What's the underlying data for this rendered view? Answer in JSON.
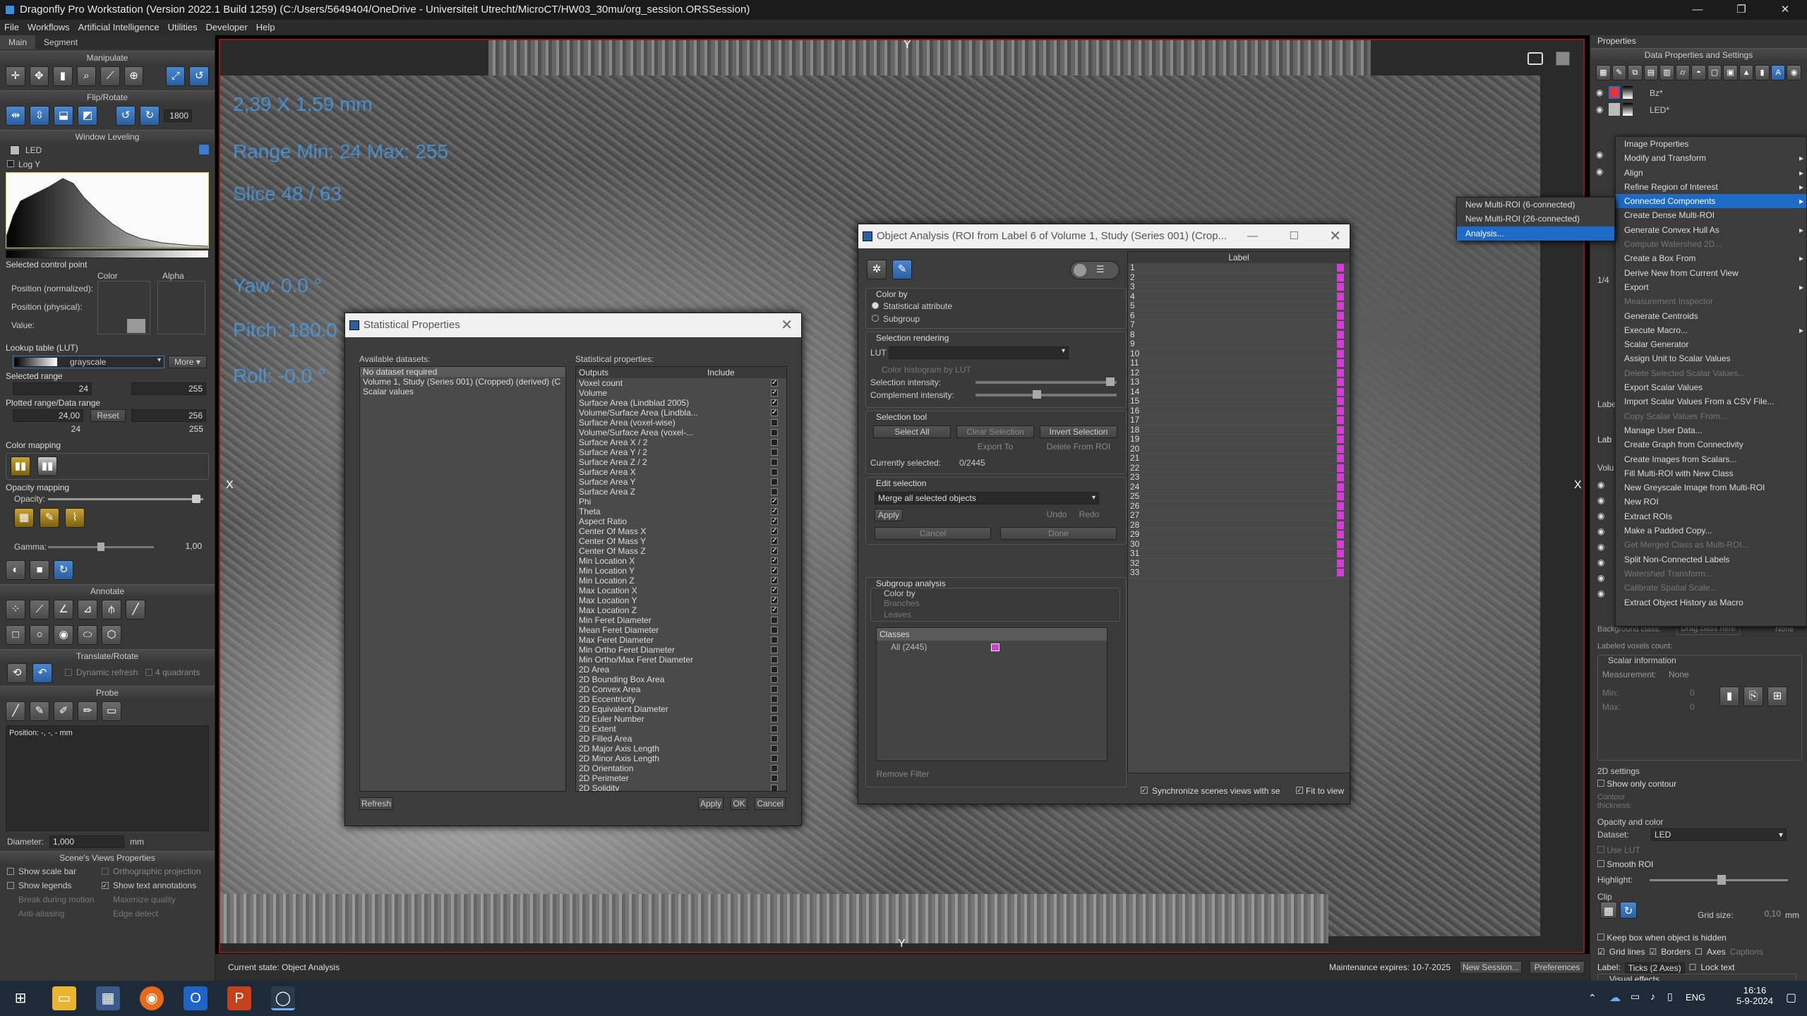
{
  "window": {
    "title": "Dragonfly Pro Workstation (Version 2022.1 Build 1259) (C:/Users/5649404/OneDrive - Universiteit Utrecht/MicroCT/HW03_30mu/org_session.ORSSession)"
  },
  "menu": [
    "File",
    "Workflows",
    "Artificial Intelligence",
    "Utilities",
    "Developer",
    "Help"
  ],
  "left": {
    "tabs": [
      "Main",
      "Segment"
    ],
    "sections": {
      "manipulate": "Manipulate",
      "flip": "Flip/Rotate",
      "window": "Window Leveling",
      "annotate": "Annotate",
      "translate": "Translate/Rotate",
      "probe": "Probe",
      "scene": "Scene's Views Properties"
    },
    "rotate_value": "1800",
    "dataset_name": "LED",
    "logy": "Log Y",
    "control_point": "Selected control point",
    "color_hdr": "Color",
    "alpha_hdr": "Alpha",
    "pos_norm": "Position (normalized):",
    "pos_phys": "Position (physical):",
    "value": "Value:",
    "lut_hdr": "Lookup table (LUT)",
    "lut_value": "grayscale",
    "more": "More",
    "sel_range": "Selected range",
    "sel_min": "24",
    "sel_max": "255",
    "plotted": "Plotted range/Data range",
    "pr_min": "24,00",
    "pr_reset": "Reset",
    "pr_max": "256",
    "dr_min": "24",
    "dr_max": "255",
    "color_mapping": "Color mapping",
    "opacity_mapping": "Opacity mapping",
    "opacity": "Opacity:",
    "gamma": "Gamma:",
    "gamma_val": "1,00",
    "dynamic_refresh": "Dynamic refresh",
    "quadrants": "4 quadrants",
    "position": "Position: -, -, - mm",
    "diameter": "Diameter:",
    "diameter_val": "1,000",
    "diameter_unit": "mm",
    "scene_opts": [
      [
        "Show scale bar",
        "Orthographic projection"
      ],
      [
        "Show legends",
        "Show text annotations"
      ],
      [
        "Break during motion",
        "Maximize quality"
      ],
      [
        "Anti-aliasing",
        "Edge detect"
      ]
    ]
  },
  "viewport": {
    "overlay": [
      "2,39 X 1,59 mm",
      "Range Min: 24 Max: 255",
      "Slice 48 / 63",
      "Yaw: 0.0 °",
      "Pitch: 180.0 °",
      "Roll: -0.0 °"
    ],
    "axis_top": "Y",
    "axis_bottom": "Y",
    "axis_left": "X",
    "axis_right": "X"
  },
  "stat": {
    "title": "Statistical Properties",
    "available": "Available datasets:",
    "datasets": [
      "No dataset required",
      "Volume 1, Study  (Series 001) (Cropped) (derived) (C",
      "Scalar values"
    ],
    "props_label": "Statistical properties:",
    "col_outputs": "Outputs",
    "col_include": "Include",
    "outputs": [
      "Voxel count",
      "Volume",
      "Surface Area (Lindblad 2005)",
      "Volume/Surface Area (Lindbla...",
      "Surface Area (voxel-wise)",
      "Volume/Surface Area (voxel-...",
      "Surface Area X / 2",
      "Surface Area Y / 2",
      "Surface Area Z / 2",
      "Surface Area X",
      "Surface Area Y",
      "Surface Area Z",
      "Phi",
      "Theta",
      "Aspect Ratio",
      "Center Of Mass X",
      "Center Of Mass Y",
      "Center Of Mass Z",
      "Min Location X",
      "Min Location Y",
      "Min Location Z",
      "Max Location X",
      "Max Location Y",
      "Max Location Z",
      "Min Feret Diameter",
      "Mean Feret Diameter",
      "Max Feret Diameter",
      "Min Ortho Feret Diameter",
      "Min Ortho/Max Feret Diameter",
      "2D Area",
      "2D Bounding Box Area",
      "2D Convex Area",
      "2D Eccentricity",
      "2D Equivalent Diameter",
      "2D Euler Number",
      "2D Extent",
      "2D Filled Area",
      "2D Major Axis Length",
      "2D Minor Axis Length",
      "2D Orientation",
      "2D Perimeter",
      "2D Solidity"
    ],
    "checked": [
      true,
      true,
      true,
      true,
      false,
      false,
      false,
      false,
      false,
      false,
      false,
      false,
      true,
      true,
      true,
      true,
      true,
      true,
      true,
      true,
      true,
      true,
      true,
      true,
      false,
      false,
      false,
      false,
      false,
      false,
      false,
      false,
      false,
      false,
      false,
      false,
      false,
      false,
      false,
      false,
      false,
      false
    ],
    "refresh": "Refresh",
    "apply": "Apply",
    "ok": "OK",
    "cancel": "Cancel"
  },
  "obj": {
    "title": "Object Analysis (ROI from Label 6 of Volume 1, Study  (Series 001) (Crop...",
    "color_by": "Color by",
    "stat_attr": "Statistical attribute",
    "subgroup": "Subgroup",
    "sel_rendering": "Selection rendering",
    "lut": "LUT",
    "color_hist": "Color histogram by LUT",
    "sel_intensity": "Selection intensity:",
    "comp_intensity": "Complement intensity:",
    "sel_tool": "Selection tool",
    "select_all": "Select All",
    "clear_sel": "Clear Selection",
    "invert_sel": "Invert Selection",
    "export_to": "Export To",
    "delete_roi": "Delete From ROI",
    "currently": "Currently selected:",
    "currently_val": "0/2445",
    "edit_sel": "Edit selection",
    "merge": "Merge all selected objects",
    "apply": "Apply",
    "undo": "Undo",
    "redo": "Redo",
    "cancel": "Cancel",
    "done": "Done",
    "subgroup_analysis": "Subgroup analysis",
    "branches": "Branches",
    "leaves": "Leaves",
    "classes": "Classes",
    "all": "All (2445)",
    "remove_filter": "Remove Filter",
    "label_hdr": "Label",
    "labels": [
      "1",
      "2",
      "3",
      "4",
      "5",
      "6",
      "7",
      "8",
      "9",
      "10",
      "11",
      "12",
      "13",
      "14",
      "15",
      "16",
      "17",
      "18",
      "19",
      "20",
      "21",
      "22",
      "23",
      "24",
      "25",
      "26",
      "27",
      "28",
      "29",
      "30",
      "31",
      "32",
      "33"
    ],
    "sync": "Synchronize scenes views with se",
    "fit": "Fit to view"
  },
  "right": {
    "properties": "Properties",
    "data_props": "Data Properties and Settings",
    "items": [
      "Bz*",
      "LED*"
    ],
    "ctx": [
      {
        "label": "Image Properties",
        "dis": false,
        "sub": false,
        "sel": false
      },
      {
        "label": "Modify and Transform",
        "dis": false,
        "sub": true,
        "sel": false
      },
      {
        "label": "Align",
        "dis": false,
        "sub": true,
        "sel": false
      },
      {
        "label": "Refine Region of Interest",
        "dis": false,
        "sub": true,
        "sel": false
      },
      {
        "label": "Connected Components",
        "dis": false,
        "sub": true,
        "sel": true
      },
      {
        "label": "Create Dense Multi-ROI",
        "dis": false,
        "sub": false,
        "sel": false
      },
      {
        "label": "Generate Convex Hull As",
        "dis": false,
        "sub": true,
        "sel": false
      },
      {
        "label": "Compute Watershed 2D...",
        "dis": true,
        "sub": false,
        "sel": false
      },
      {
        "label": "Create a Box From",
        "dis": false,
        "sub": true,
        "sel": false
      },
      {
        "label": "Derive New from Current View",
        "dis": false,
        "sub": false,
        "sel": false
      },
      {
        "label": "Export",
        "dis": false,
        "sub": true,
        "sel": false
      },
      {
        "label": "Measurement Inspector",
        "dis": true,
        "sub": false,
        "sel": false
      },
      {
        "label": "Generate Centroids",
        "dis": false,
        "sub": false,
        "sel": false
      },
      {
        "label": "Execute Macro...",
        "dis": false,
        "sub": true,
        "sel": false
      },
      {
        "label": "Scalar Generator",
        "dis": false,
        "sub": false,
        "sel": false
      },
      {
        "label": "Assign Unit to Scalar Values",
        "dis": false,
        "sub": false,
        "sel": false
      },
      {
        "label": "Delete Selected Scalar Values...",
        "dis": true,
        "sub": false,
        "sel": false
      },
      {
        "label": "Export Scalar Values",
        "dis": false,
        "sub": false,
        "sel": false
      },
      {
        "label": "Import Scalar Values From a CSV File...",
        "dis": false,
        "sub": false,
        "sel": false
      },
      {
        "label": "Copy Scalar Values From...",
        "dis": true,
        "sub": false,
        "sel": false
      },
      {
        "label": "Manage User Data...",
        "dis": false,
        "sub": false,
        "sel": false
      },
      {
        "label": "Create Graph from Connectivity",
        "dis": false,
        "sub": false,
        "sel": false
      },
      {
        "label": "Create Images from Scalars...",
        "dis": false,
        "sub": false,
        "sel": false
      },
      {
        "label": "Fill Multi-ROI with New Class",
        "dis": false,
        "sub": false,
        "sel": false
      },
      {
        "label": "New Greyscale Image from Multi-ROI",
        "dis": false,
        "sub": false,
        "sel": false
      },
      {
        "label": "New ROI",
        "dis": false,
        "sub": false,
        "sel": false
      },
      {
        "label": "Extract ROIs",
        "dis": false,
        "sub": false,
        "sel": false
      },
      {
        "label": "Make a Padded Copy...",
        "dis": false,
        "sub": false,
        "sel": false
      },
      {
        "label": "Get Merged Class as Multi-ROI...",
        "dis": true,
        "sub": false,
        "sel": false
      },
      {
        "label": "Split Non-Connected Labels",
        "dis": false,
        "sub": false,
        "sel": false
      },
      {
        "label": "Watershed Transform...",
        "dis": true,
        "sub": false,
        "sel": false
      },
      {
        "label": "Calibrate Spatial Scale...",
        "dis": true,
        "sub": false,
        "sel": false
      },
      {
        "label": "Extract Object History as Macro",
        "dis": false,
        "sub": false,
        "sel": false
      }
    ],
    "submenu": [
      "New Multi-ROI (6-connected)",
      "New Multi-ROI (26-connected)",
      "Analysis..."
    ],
    "bg_class": "Background class:",
    "drag_class": "Drag class here",
    "none": "None",
    "labeled_voxels": "Labeled voxels count:",
    "scalar_info": "Scalar information",
    "measurement": "Measurement:",
    "meas_val": "None",
    "min": "Min:",
    "max": "Max:",
    "zero": "0",
    "settings2d": "2D settings",
    "only_contour": "Show only contour",
    "contour_thickness": "Contour thickness:",
    "opacity_color": "Opacity and color",
    "dataset": "Dataset:",
    "dataset_val": "LED",
    "use_lut": "Use LUT",
    "smooth": "Smooth ROI",
    "highlight": "Highlight:",
    "clip": "Clip",
    "grid_size": "Grid size:",
    "grid_val": "0,10",
    "grid_unit": "mm",
    "keep_box": "Keep box when object is hidden",
    "grid_lines": "Grid lines",
    "borders": "Borders",
    "axes": "Axes",
    "captions": "Captions",
    "label": "Label:",
    "ticks": "Ticks (2 Axes)",
    "lock_text": "Lock text",
    "visual_effects": "Visual effects",
    "page_frac": "1/4",
    "lab1": "Labe",
    "lab2": "Lab",
    "vol": "Volu"
  },
  "status": {
    "state": "Current state: Object Analysis",
    "maint": "Maintenance expires: 10-7-2025",
    "new_session": "New Session...",
    "preferences": "Preferences"
  },
  "taskbar": {
    "lang": "ENG",
    "time": "16:16",
    "date": "5-9-2024"
  }
}
